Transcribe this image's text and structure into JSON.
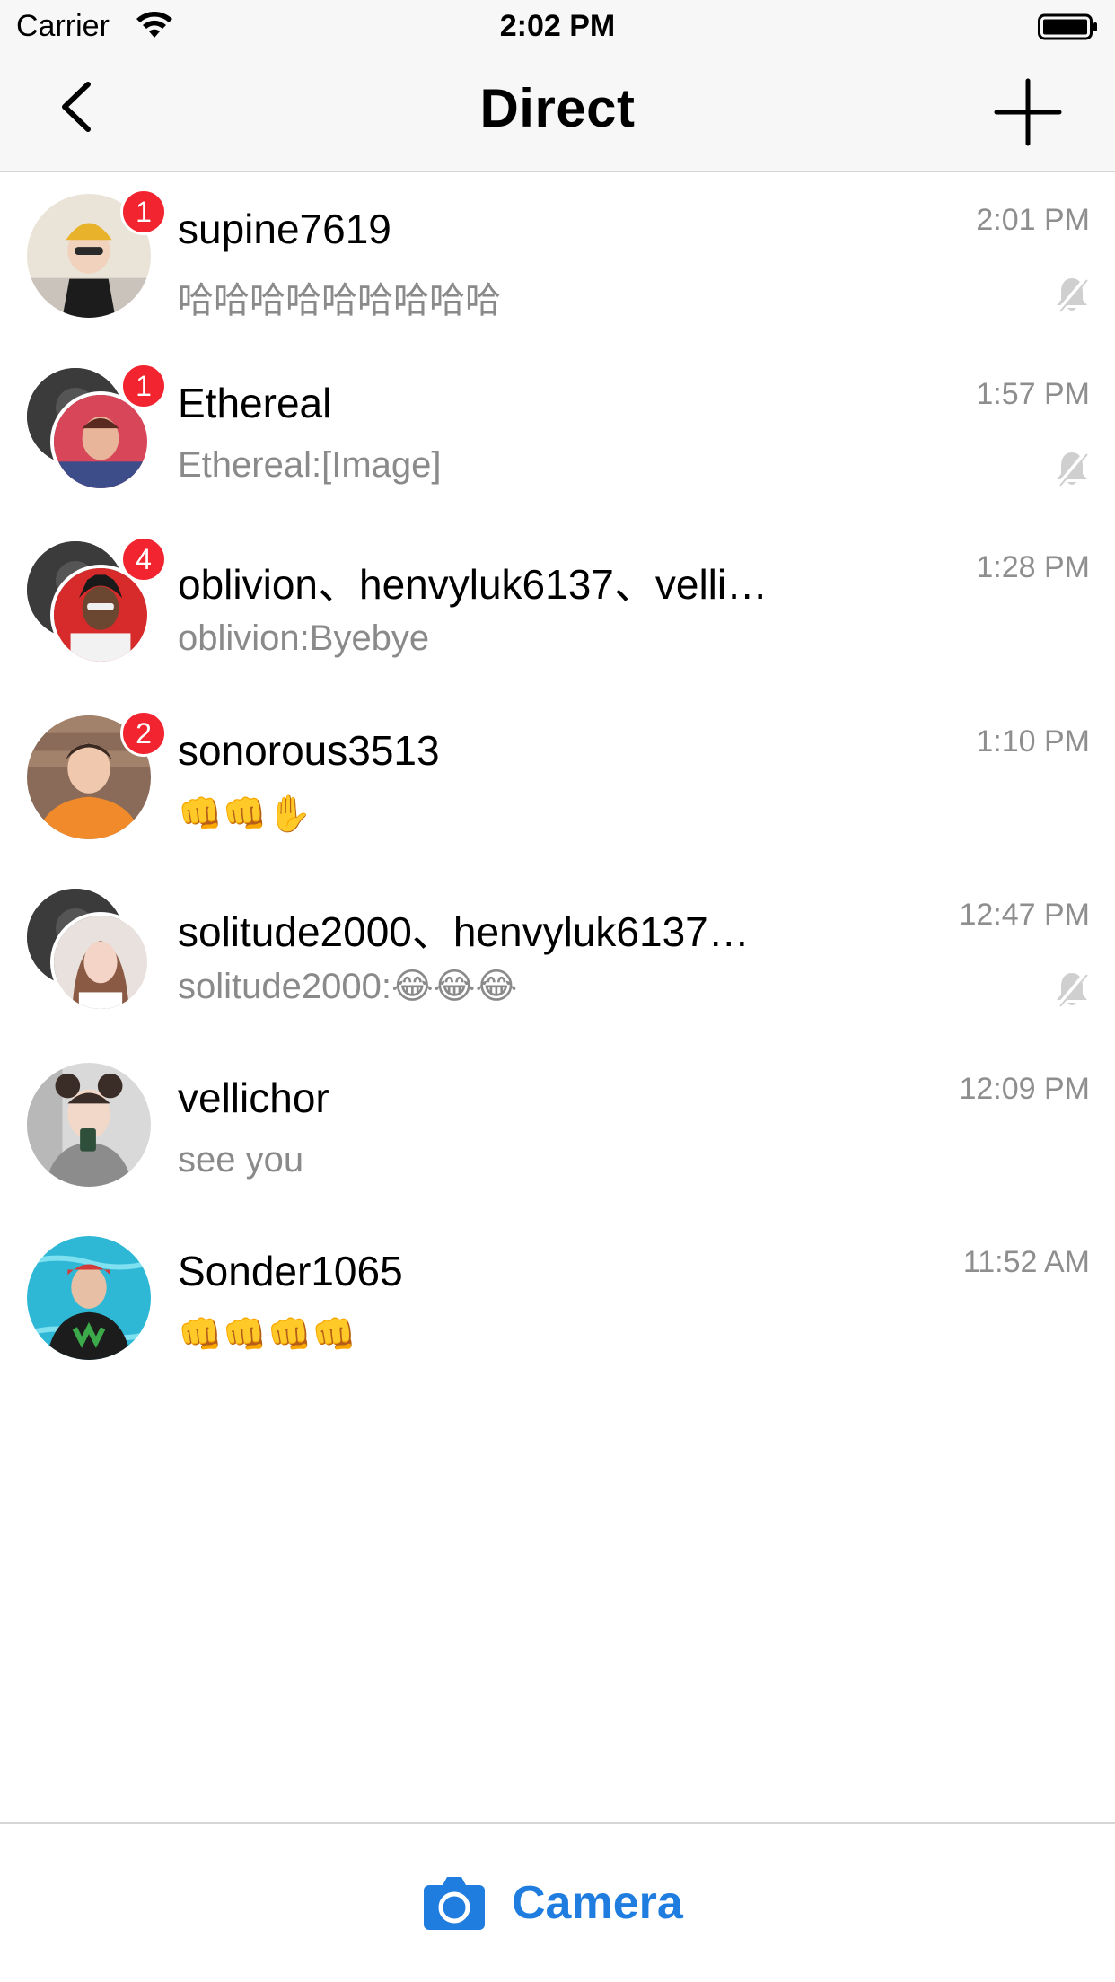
{
  "status_bar": {
    "carrier": "Carrier",
    "time": "2:02 PM"
  },
  "nav": {
    "title": "Direct",
    "back_icon": "chevron-left-icon",
    "add_icon": "plus-icon"
  },
  "conversations": [
    {
      "name": "supine7619",
      "preview": "哈哈哈哈哈哈哈哈哈",
      "time": "2:01 PM",
      "badge": "1",
      "muted": true,
      "group": false
    },
    {
      "name": "Ethereal",
      "preview": "Ethereal:[Image]",
      "time": "1:57 PM",
      "badge": "1",
      "muted": true,
      "group": true
    },
    {
      "name": "oblivion、henvyluk6137、velli…",
      "preview": "oblivion:Byebye",
      "time": "1:28 PM",
      "badge": "4",
      "muted": false,
      "group": true
    },
    {
      "name": "sonorous3513",
      "preview": "👊👊✋",
      "time": "1:10 PM",
      "badge": "2",
      "muted": false,
      "group": false
    },
    {
      "name": "solitude2000、henvyluk6137…",
      "preview": "solitude2000:😂😂😂",
      "time": "12:47 PM",
      "badge": "",
      "muted": true,
      "group": true
    },
    {
      "name": "vellichor",
      "preview": "see you",
      "time": "12:09 PM",
      "badge": "",
      "muted": false,
      "group": false
    },
    {
      "name": "Sonder1065",
      "preview": "👊👊👊👊",
      "time": "11:52 AM",
      "badge": "",
      "muted": false,
      "group": false
    }
  ],
  "bottom": {
    "camera_label": "Camera",
    "camera_icon": "camera-icon"
  },
  "colors": {
    "accent": "#1f7de0",
    "badge": "#f2242f",
    "secondary_text": "#8a8a8a",
    "bar_bg": "#f7f7f7"
  }
}
